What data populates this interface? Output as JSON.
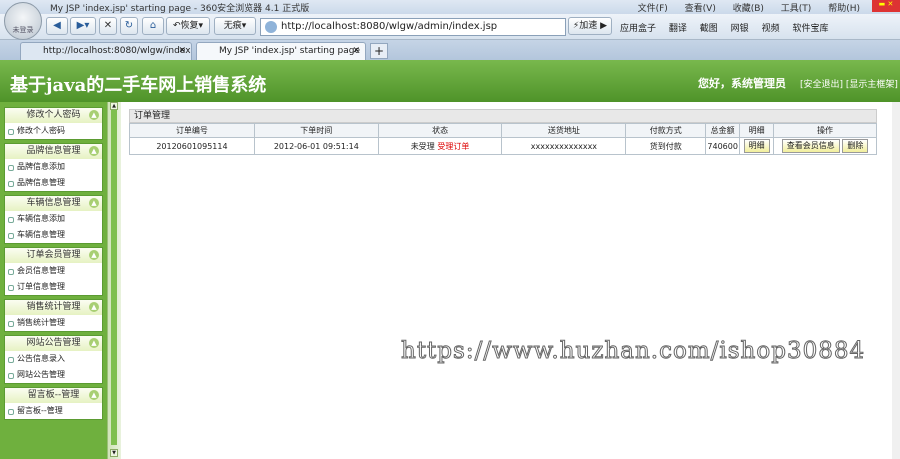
{
  "browser": {
    "window_title": "My JSP 'index.jsp' starting page - 360安全浏览器 4.1 正式版",
    "avatar_label": "未登录",
    "menus": [
      "文件(F)",
      "查看(V)",
      "收藏(B)",
      "工具(T)",
      "帮助(H)"
    ],
    "toolbar": {
      "restore_label": "恢复",
      "no_trace_label": "无痕",
      "address": "http://localhost:8080/wlgw/admin/index.jsp",
      "accelerate_label": "加速",
      "right_items": [
        "应用盒子",
        "翻译",
        "截图",
        "网银",
        "视频",
        "软件宝库"
      ]
    },
    "tabs": [
      {
        "label": "http://localhost:8080/wlgw/index"
      },
      {
        "label": "My JSP 'index.jsp' starting page"
      }
    ]
  },
  "app": {
    "title": "基于java的二手车网上销售系统",
    "greeting": "您好，系统管理员",
    "logout_link": "[安全退出]",
    "show_frame_link": "[显示主框架]"
  },
  "sidebar": {
    "groups": [
      {
        "title": "修改个人密码",
        "items": [
          "修改个人密码"
        ]
      },
      {
        "title": "品牌信息管理",
        "items": [
          "品牌信息添加",
          "品牌信息管理"
        ]
      },
      {
        "title": "车辆信息管理",
        "items": [
          "车辆信息添加",
          "车辆信息管理"
        ]
      },
      {
        "title": "订单会员管理",
        "items": [
          "会员信息管理",
          "订单信息管理"
        ]
      },
      {
        "title": "销售统计管理",
        "items": [
          "销售统计管理"
        ]
      },
      {
        "title": "网站公告管理",
        "items": [
          "公告信息录入",
          "网站公告管理"
        ]
      },
      {
        "title": "留言板--管理",
        "items": [
          "留言板--管理"
        ]
      }
    ]
  },
  "main": {
    "panel_title": "订单管理",
    "columns": [
      "订单编号",
      "下单时间",
      "状态",
      "送货地址",
      "付款方式",
      "总金额",
      "明细",
      "操作"
    ],
    "rows": [
      {
        "order_no": "20120601095114",
        "time": "2012-06-01 09:51:14",
        "status": "未受理",
        "status_action": "受理订单",
        "address": "xxxxxxxxxxxxxx",
        "payment": "货到付款",
        "total": "740600",
        "detail_btn": "明细",
        "view_member_btn": "查看会员信息",
        "delete_btn": "删除"
      }
    ]
  },
  "watermark": "https://www.huzhan.com/ishop30884"
}
